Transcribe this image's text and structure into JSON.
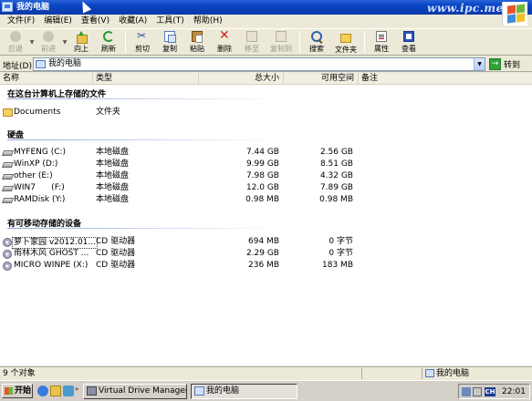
{
  "window": {
    "title": "我的电脑",
    "watermark": "www.ipc.me"
  },
  "menu": [
    "文件(F)",
    "编辑(E)",
    "查看(V)",
    "收藏(A)",
    "工具(T)",
    "帮助(H)"
  ],
  "toolbar": {
    "back": "后退",
    "forward": "前进",
    "up": "向上",
    "refresh": "刷新",
    "cut": "剪切",
    "copy": "复制",
    "paste": "粘贴",
    "delete": "删除",
    "move_to": "移至",
    "copy_to": "复制到",
    "search": "搜索",
    "folders": "文件夹",
    "properties": "属性",
    "views": "查看"
  },
  "address": {
    "label": "地址(D)",
    "value": "我的电脑",
    "go": "转到"
  },
  "columns": {
    "name": "名称",
    "type": "类型",
    "total": "总大小",
    "free": "可用空间",
    "notes": "备注"
  },
  "groups": {
    "stored": "在这台计算机上存储的文件",
    "hdd": "硬盘",
    "removable": "有可移动存储的设备"
  },
  "stored_items": [
    {
      "name": "Documents",
      "type": "文件夹",
      "total": "",
      "free": ""
    }
  ],
  "hdd_items": [
    {
      "name": "MYFENG (C:)",
      "type": "本地磁盘",
      "total": "7.44 GB",
      "free": "2.56 GB"
    },
    {
      "name": "WinXP (D:)",
      "type": "本地磁盘",
      "total": "9.99 GB",
      "free": "8.51 GB"
    },
    {
      "name": "other (E:)",
      "type": "本地磁盘",
      "total": "7.98 GB",
      "free": "4.32 GB"
    },
    {
      "name": "WIN7      (F:)",
      "type": "本地磁盘",
      "total": "12.0 GB",
      "free": "7.89 GB"
    },
    {
      "name": "RAMDisk (Y:)",
      "type": "本地磁盘",
      "total": "0.98 MB",
      "free": "0.98 MB"
    }
  ],
  "removable_items": [
    {
      "name": "萝卜家园 v2012.01...",
      "type": "CD 驱动器",
      "total": "694 MB",
      "free": "0 字节"
    },
    {
      "name": "雨林木风 GHOST ...",
      "type": "CD 驱动器",
      "total": "2.29 GB",
      "free": "0 字节"
    },
    {
      "name": "MICRO WINPE (X:)",
      "type": "CD 驱动器",
      "total": "236 MB",
      "free": "183 MB"
    }
  ],
  "status": {
    "left": "9 个对象",
    "right": "我的电脑"
  },
  "taskbar": {
    "start": "开始",
    "quick_more": "»",
    "buttons": [
      "Virtual Drive Manager ...",
      "我的电脑"
    ],
    "tray_lang": "CH",
    "clock": "22:01"
  }
}
